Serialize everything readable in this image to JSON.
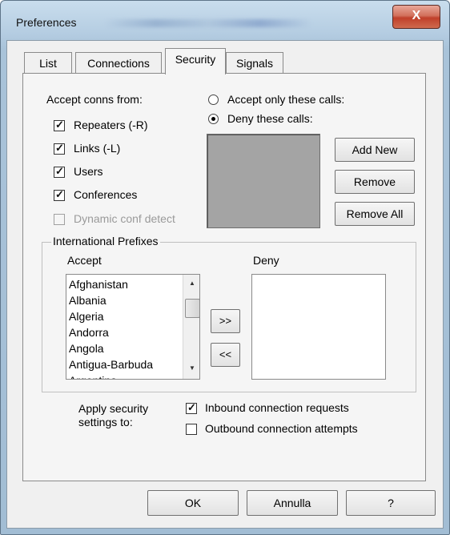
{
  "window": {
    "title": "Preferences",
    "close_label": "X"
  },
  "tabs": [
    {
      "label": "List"
    },
    {
      "label": "Connections"
    },
    {
      "label": "Security"
    },
    {
      "label": "Signals"
    }
  ],
  "accept_conns": {
    "label": "Accept conns from:",
    "options": [
      {
        "label": "Repeaters (-R)",
        "checked": true
      },
      {
        "label": "Links (-L)",
        "checked": true
      },
      {
        "label": "Users",
        "checked": true
      },
      {
        "label": "Conferences",
        "checked": true
      },
      {
        "label": "Dynamic conf detect",
        "checked": false,
        "disabled": true
      }
    ]
  },
  "calls": {
    "accept_only_label": "Accept only these calls:",
    "deny_label": "Deny these calls:",
    "selected": "deny",
    "add_new_label": "Add New",
    "remove_label": "Remove",
    "remove_all_label": "Remove All"
  },
  "prefixes": {
    "group_label": "International Prefixes",
    "accept_label": "Accept",
    "deny_label": "Deny",
    "accept_items": [
      "Afghanistan",
      "Albania",
      "Algeria",
      "Andorra",
      "Angola",
      "Antigua-Barbuda",
      "Argentina"
    ],
    "deny_items": [],
    "move_right_label": ">>",
    "move_left_label": "<<"
  },
  "apply": {
    "label_line1": "Apply security",
    "label_line2": "settings to:",
    "inbound_label": "Inbound connection requests",
    "inbound_checked": true,
    "outbound_label": "Outbound connection attempts",
    "outbound_checked": false
  },
  "footer": {
    "ok_label": "OK",
    "cancel_label": "Annulla",
    "help_label": "?"
  }
}
